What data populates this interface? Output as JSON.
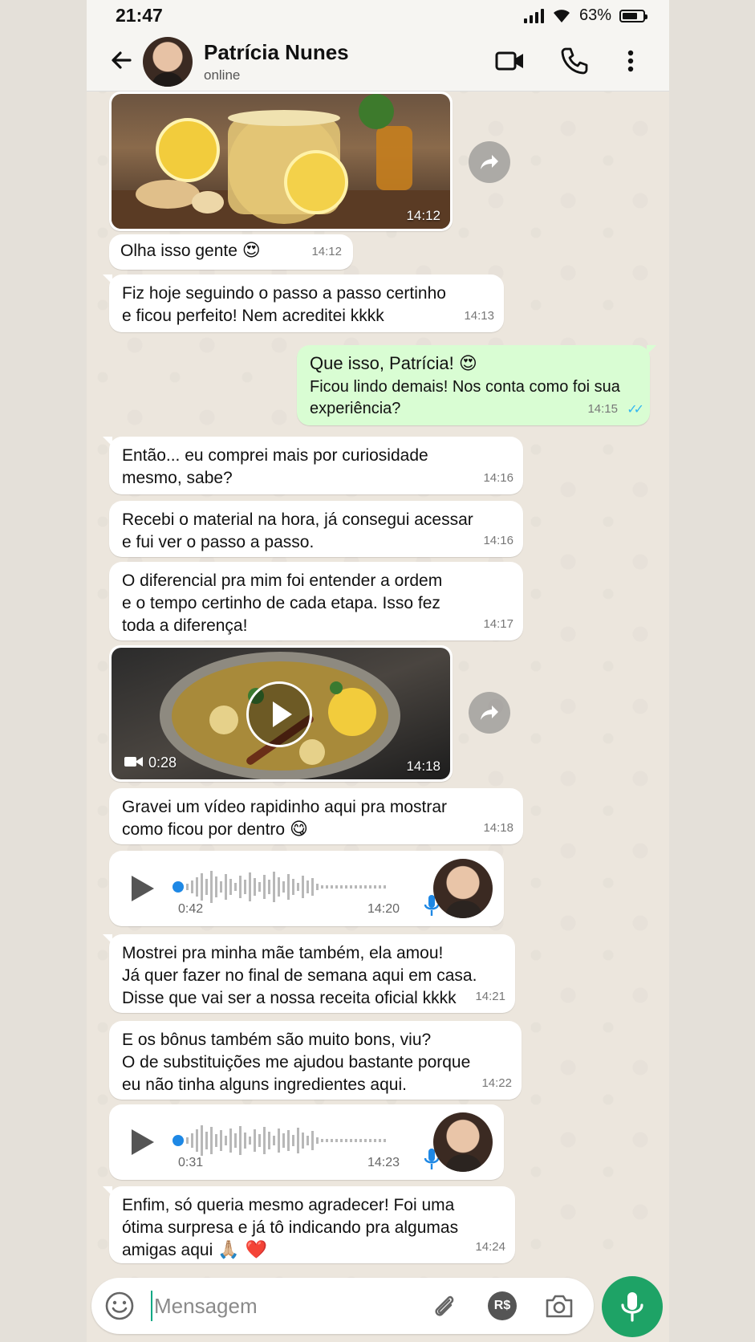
{
  "status_bar": {
    "time": "21:47",
    "battery": "63%"
  },
  "header": {
    "contact_name": "Patrícia Nunes",
    "contact_status": "online"
  },
  "messages": [
    {
      "type": "image",
      "direction": "in",
      "time": "14:12"
    },
    {
      "type": "text",
      "direction": "in",
      "text": "Olha isso gente",
      "emoji": "😍",
      "time": "14:12"
    },
    {
      "type": "text",
      "direction": "in",
      "text": "Fiz hoje seguindo o passo a passo certinho\ne ficou perfeito! Nem acreditei kkkk",
      "time": "14:13"
    },
    {
      "type": "text",
      "direction": "out",
      "title": "Que isso, Patrícia!",
      "emoji": "😍",
      "text": "Ficou lindo demais! Nos conta como foi sua\nexperiência?",
      "time": "14:15",
      "read": "✓✓"
    },
    {
      "type": "text",
      "direction": "in",
      "text": "Então... eu comprei mais por curiosidade\nmesmo, sabe?",
      "time": "14:16"
    },
    {
      "type": "text",
      "direction": "in",
      "text": "Recebi o material na hora, já consegui acessar\ne fui ver o passo a passo.",
      "time": "14:16"
    },
    {
      "type": "text",
      "direction": "in",
      "text": "O diferencial pra mim foi entender a ordem\ne o tempo certinho de cada etapa. Isso fez\ntoda a diferença!",
      "time": "14:17"
    },
    {
      "type": "video",
      "direction": "in",
      "duration": "0:28",
      "time": "14:18"
    },
    {
      "type": "text",
      "direction": "in",
      "text": "Gravei um vídeo rapidinho aqui pra mostrar\ncomo ficou por dentro",
      "emoji": "😋",
      "time": "14:18"
    },
    {
      "type": "audio",
      "direction": "in",
      "duration": "0:42",
      "time": "14:20"
    },
    {
      "type": "text",
      "direction": "in",
      "text": "Mostrei pra minha mãe também, ela amou!\nJá quer fazer no final de semana aqui em casa.\nDisse que vai ser a nossa receita oficial kkkk",
      "time": "14:21"
    },
    {
      "type": "text",
      "direction": "in",
      "text": "E os bônus também são muito bons, viu?\nO de substituições me ajudou bastante porque\neu não tinha alguns ingredientes aqui.",
      "time": "14:22"
    },
    {
      "type": "audio",
      "direction": "in",
      "duration": "0:31",
      "time": "14:23"
    },
    {
      "type": "text",
      "direction": "in",
      "text": "Enfim, só queria mesmo agradecer! Foi uma\nótima surpresa e já tô indicando pra algumas\namigas aqui",
      "emoji": "🙏🏼 ❤️",
      "time": "14:24"
    }
  ],
  "input": {
    "placeholder": "Mensagem",
    "currency_label": "R$"
  },
  "colors": {
    "outgoing_bubble": "#d9fdd3",
    "incoming_bubble": "#ffffff",
    "accent": "#1ea366",
    "read_ticks": "#34b7f1"
  }
}
